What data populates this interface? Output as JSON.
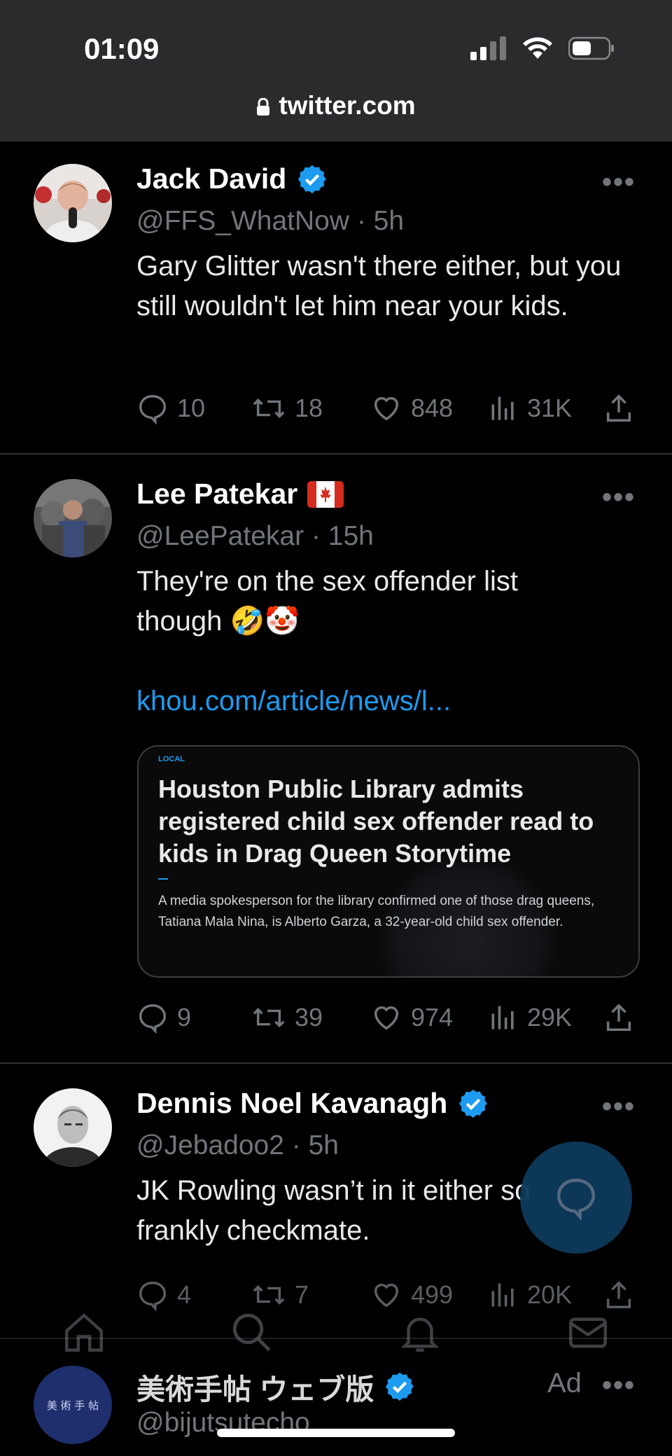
{
  "status_bar": {
    "time": "01:09"
  },
  "browser": {
    "url": "twitter.com"
  },
  "tweets": [
    {
      "name": "Jack David",
      "handle": "@FFS_WhatNow",
      "time": "5h",
      "text": "Gary Glitter wasn't there either, but you still wouldn't let him near your kids.",
      "stats": {
        "replies": "10",
        "retweets": "18",
        "likes": "848",
        "views": "31K"
      }
    },
    {
      "name": "Lee Patekar",
      "handle": "@LeePatekar",
      "time": "15h",
      "text": "They're on the sex offender list though 🤣🤡",
      "link": "khou.com/article/news/l...",
      "card": {
        "tag": "LOCAL",
        "headline": "Houston Public Library admits registered child sex offender read to kids in Drag Queen Storytime",
        "description": "A media spokesperson for the library confirmed one of those drag queens, Tatiana Mala Nina, is Alberto Garza, a 32-year-old child sex offender."
      },
      "stats": {
        "replies": "9",
        "retweets": "39",
        "likes": "974",
        "views": "29K"
      }
    },
    {
      "name": "Dennis Noel Kavanagh",
      "handle": "@Jebadoo2",
      "time": "5h",
      "text": "JK Rowling wasn’t in it either so frankly checkmate.",
      "stats": {
        "replies": "4",
        "retweets": "7",
        "likes": "499",
        "views": "20K"
      }
    },
    {
      "name": "美術手帖 ウェブ版",
      "handle": "@bijutsutecho",
      "avatar_text": "美 術 手 帖",
      "ad_label": "Ad"
    }
  ],
  "colors": {
    "accent": "#1d9bf0",
    "background": "#000000",
    "muted": "#71767b"
  }
}
